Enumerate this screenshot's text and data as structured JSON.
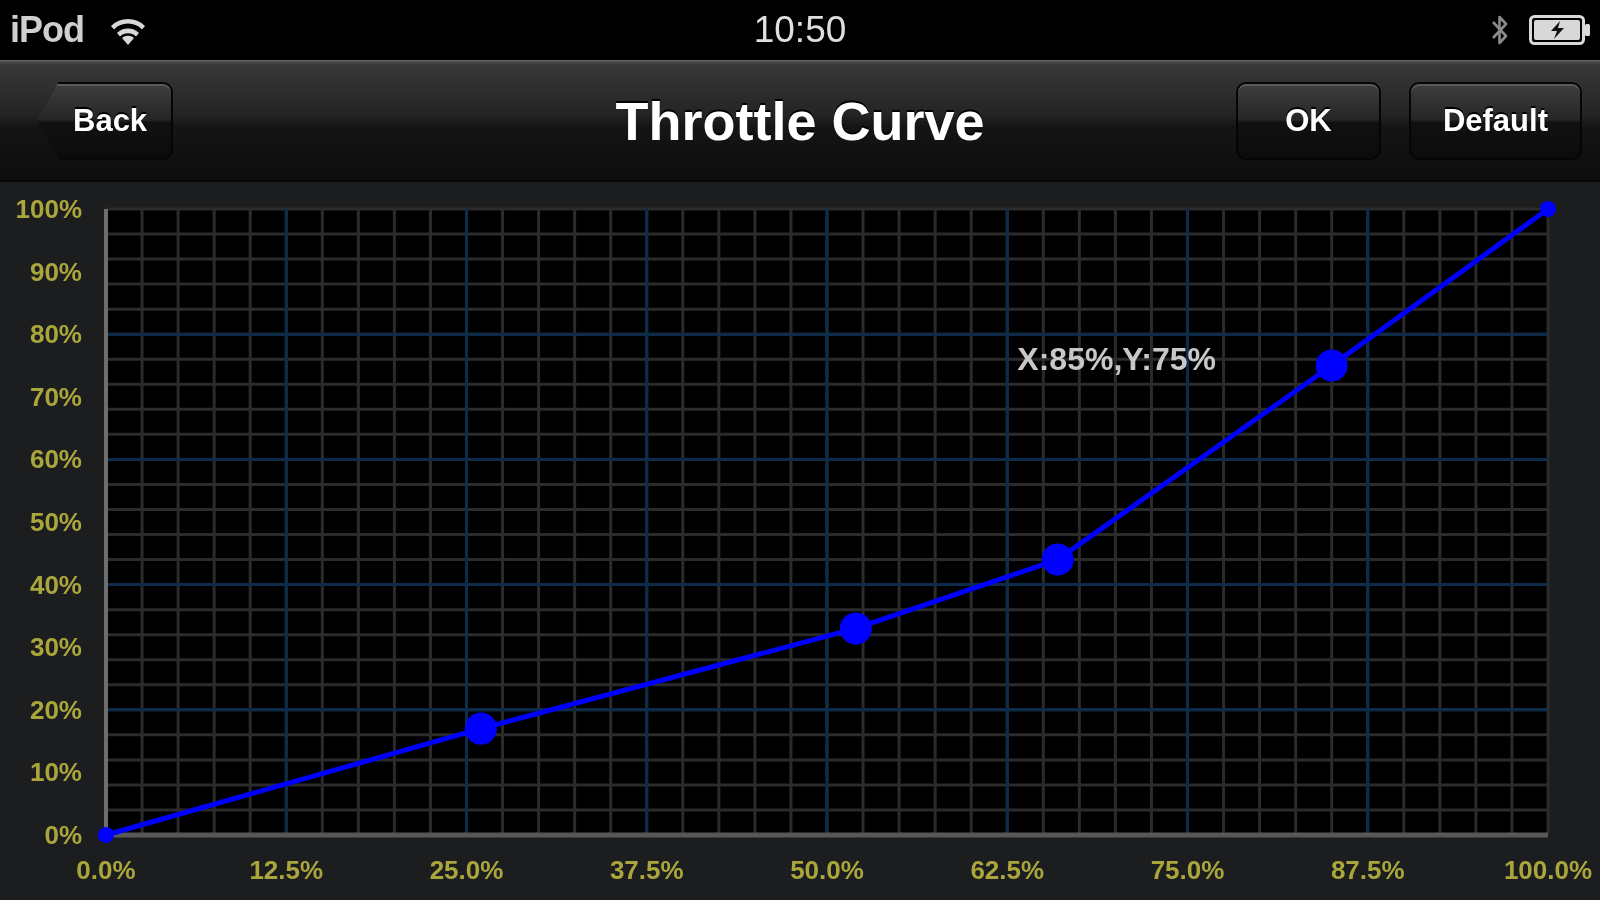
{
  "status_bar": {
    "carrier": "iPod",
    "time": "10:50"
  },
  "nav_bar": {
    "back_button": "Back",
    "title": "Throttle Curve",
    "buttons": [
      "OK",
      "Default"
    ]
  },
  "curve_editor": {
    "chart_data": [
      {
        "type": "line",
        "x": [
          0,
          26,
          52,
          66,
          85,
          100
        ],
        "values": [
          0,
          17,
          33,
          44,
          75,
          100
        ],
        "color": "#0000ff",
        "marker": "circle",
        "grid": true,
        "xlim": [
          0,
          100
        ],
        "ylim": [
          0,
          100
        ],
        "xticks": [
          {
            "value": 0,
            "label": "0.0%"
          },
          {
            "value": 12.5,
            "label": "12.5%"
          },
          {
            "value": 25,
            "label": "25.0%"
          },
          {
            "value": 37.5,
            "label": "37.5%"
          },
          {
            "value": 50,
            "label": "50.0%"
          },
          {
            "value": 62.5,
            "label": "62.5%"
          },
          {
            "value": 75,
            "label": "75.0%"
          },
          {
            "value": 87.5,
            "label": "87.5%"
          },
          {
            "value": 100,
            "label": "100.0%"
          }
        ],
        "yticks": [
          {
            "value": 0,
            "label": "0%"
          },
          {
            "value": 10,
            "label": "10%"
          },
          {
            "value": 20,
            "label": "20%"
          },
          {
            "value": 30,
            "label": "30%"
          },
          {
            "value": 40,
            "label": "40%"
          },
          {
            "value": 50,
            "label": "50%"
          },
          {
            "value": 60,
            "label": "60%"
          },
          {
            "value": 70,
            "label": "70%"
          },
          {
            "value": 80,
            "label": "80%"
          },
          {
            "value": 90,
            "label": "90%"
          },
          {
            "value": 100,
            "label": "100%"
          }
        ],
        "annotations": [
          "X:85%,Y:75%"
        ]
      }
    ]
  }
}
